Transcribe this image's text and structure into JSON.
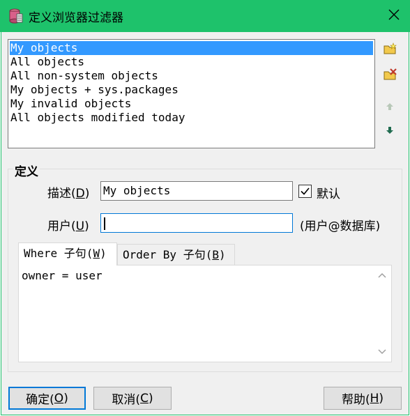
{
  "window": {
    "title": "定义浏览器过滤器",
    "icon": "database-filter-icon",
    "close_icon": "close-icon"
  },
  "filter_list": {
    "items": [
      "My objects",
      "All objects",
      "All non-system objects",
      "My objects + sys.packages",
      "My invalid objects",
      "All objects modified today"
    ],
    "selected_index": 0
  },
  "side_toolbar": {
    "new_icon": "new-folder-icon",
    "delete_icon": "delete-folder-icon",
    "up_icon": "arrow-up-icon",
    "down_icon": "arrow-down-icon"
  },
  "definition": {
    "group_title": "定义",
    "description_label": "描述(",
    "description_key": "D",
    "description_label_end": ")",
    "description_value": "My objects",
    "default_label": "默认",
    "default_checked": true,
    "user_label": "用户(",
    "user_key": "U",
    "user_label_end": ")",
    "user_value": "",
    "user_hint": "(用户@数据库)"
  },
  "tabs": [
    {
      "label": "Where 子句(",
      "key": "W",
      "end": ")",
      "active": true
    },
    {
      "label": "Order By 子句(",
      "key": "B",
      "end": ")",
      "active": false
    }
  ],
  "where_clause": "owner = user",
  "buttons": {
    "ok": {
      "label": "确定(",
      "key": "O",
      "end": ")"
    },
    "cancel": {
      "label": "取消(",
      "key": "C",
      "end": ")"
    },
    "help": {
      "label": "帮助(",
      "key": "H",
      "end": ")"
    }
  },
  "colors": {
    "titlebar": "#1ec26b",
    "selection": "#3399ff",
    "focus_border": "#0078d7"
  }
}
